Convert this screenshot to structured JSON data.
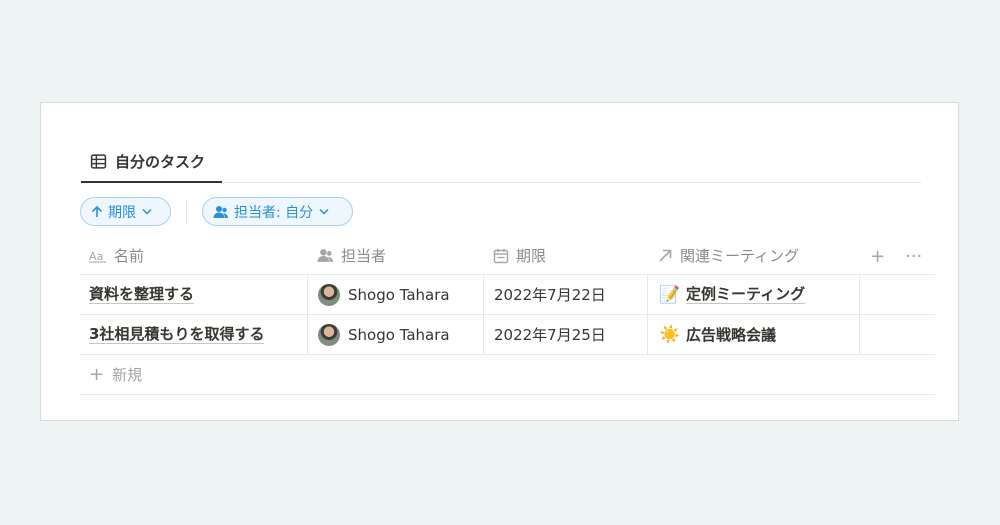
{
  "colors": {
    "accent": "#2a8ed3",
    "background": "#eef3f3",
    "text": "#37352f"
  },
  "view": {
    "tab_label": "自分のタスク",
    "tab_icon": "table-icon"
  },
  "filters": {
    "sort_label": "期限",
    "sort_icon": "arrow-up-icon",
    "person_label": "担当者: 自分",
    "person_icon": "person-icon"
  },
  "table": {
    "columns": [
      {
        "label": "名前",
        "icon": "text-property-icon"
      },
      {
        "label": "担当者",
        "icon": "person-property-icon"
      },
      {
        "label": "期限",
        "icon": "calendar-icon"
      },
      {
        "label": "関連ミーティング",
        "icon": "relation-arrow-icon"
      }
    ],
    "rows": [
      {
        "name": "資料を整理する",
        "assignee": "Shogo Tahara",
        "due": "2022年7月22日",
        "meeting_emoji": "📝",
        "meeting": "定例ミーティング"
      },
      {
        "name": "3社相見積もりを取得する",
        "assignee": "Shogo Tahara",
        "due": "2022年7月25日",
        "meeting_emoji": "☀️",
        "meeting": "広告戦略会議"
      }
    ],
    "add_column": "+",
    "more": "···",
    "new_label": "新規"
  }
}
